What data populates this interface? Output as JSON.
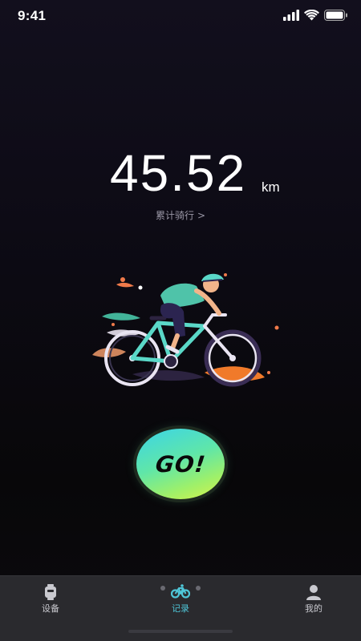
{
  "status_bar": {
    "time": "9:41"
  },
  "summary": {
    "distance_value": "45.52",
    "distance_unit": "km",
    "cumulative_label": "累计骑行",
    "cumulative_chevron": ">"
  },
  "illustration": {
    "icon": "cyclist-illustration"
  },
  "action": {
    "go_label": "GO!",
    "colors": [
      "#3bd4e8",
      "#9ef06a",
      "#d8f24a"
    ]
  },
  "tab_bar": {
    "tabs": [
      {
        "label": "设备",
        "icon": "watch-icon",
        "active": false
      },
      {
        "label": "记录",
        "icon": "bicycle-icon",
        "active": true
      },
      {
        "label": "我的",
        "icon": "user-icon",
        "active": false
      }
    ],
    "active_color": "#4fc6d8"
  }
}
